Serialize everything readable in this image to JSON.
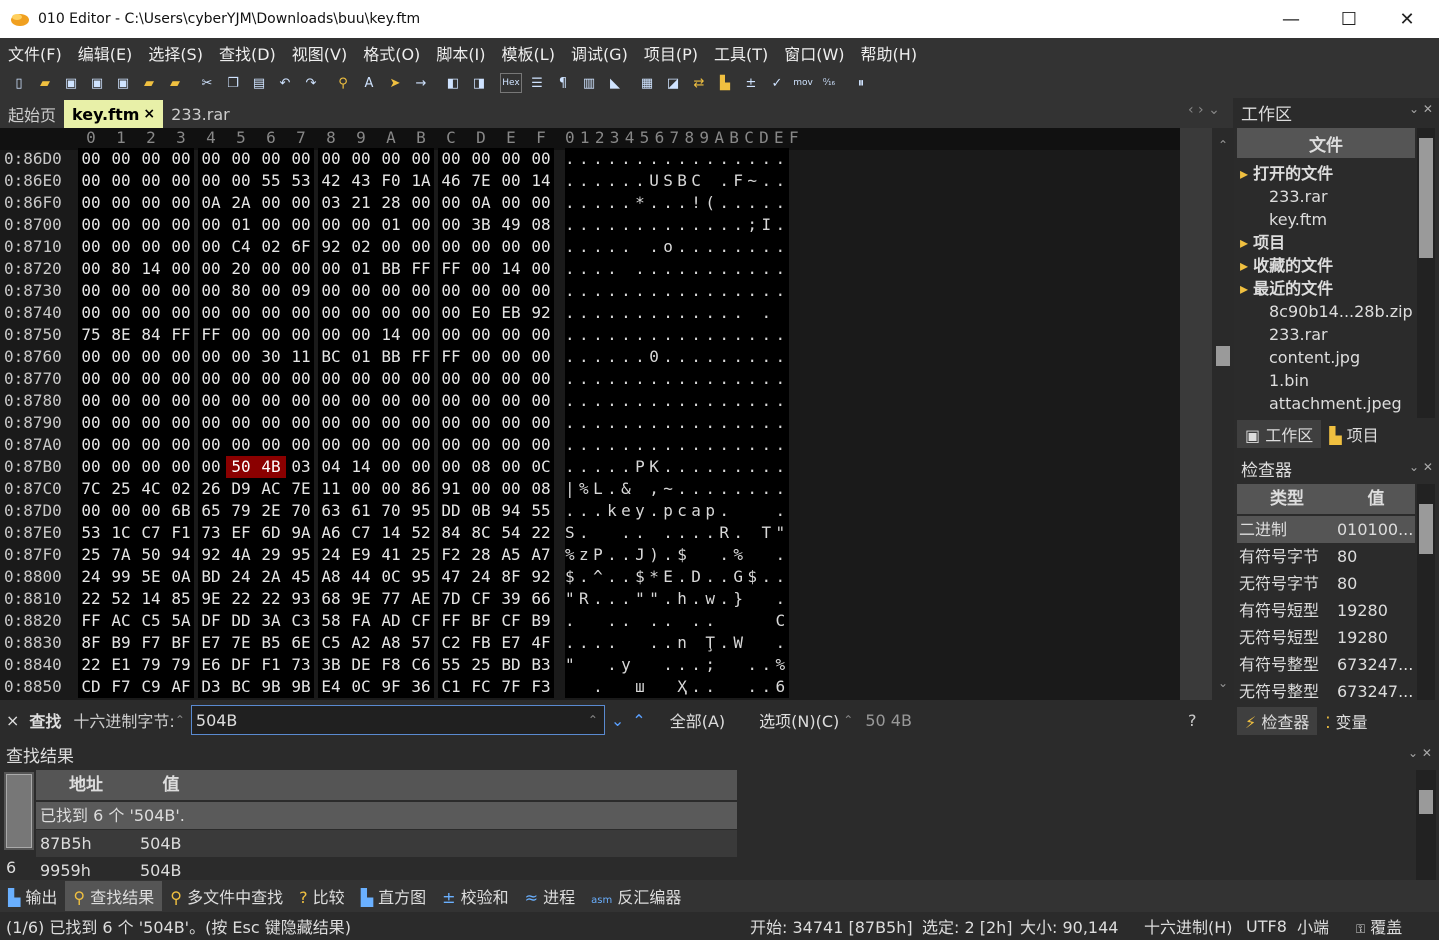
{
  "window": {
    "title": "010 Editor - C:\\Users\\cyberYJM\\Downloads\\buu\\key.ftm",
    "minimize": "—",
    "maximize": "☐",
    "close": "✕"
  },
  "menu": [
    "文件(F)",
    "编辑(E)",
    "选择(S)",
    "查找(D)",
    "视图(V)",
    "格式(O)",
    "脚本(I)",
    "模板(L)",
    "调试(G)",
    "项目(P)",
    "工具(T)",
    "窗口(W)",
    "帮助(H)"
  ],
  "tabs": {
    "start": "起始页",
    "active": "key.ftm",
    "active_close": "×",
    "other": "233.rar"
  },
  "hex": {
    "header_cols": [
      "0",
      "1",
      "2",
      "3",
      "4",
      "5",
      "6",
      "7",
      "8",
      "9",
      "A",
      "B",
      "C",
      "D",
      "E",
      "F"
    ],
    "ascii_header": "0123456789ABCDEF",
    "rows": [
      {
        "addr": "0:86D0",
        "bytes": [
          "00",
          "00",
          "00",
          "00",
          "00",
          "00",
          "00",
          "00",
          "00",
          "00",
          "00",
          "00",
          "00",
          "00",
          "00",
          "00"
        ],
        "ascii": "................"
      },
      {
        "addr": "0:86E0",
        "bytes": [
          "00",
          "00",
          "00",
          "00",
          "00",
          "00",
          "55",
          "53",
          "42",
          "43",
          "F0",
          "1A",
          "46",
          "7E",
          "00",
          "14"
        ],
        "ascii": "......USBC .F~.."
      },
      {
        "addr": "0:86F0",
        "bytes": [
          "00",
          "00",
          "00",
          "00",
          "0A",
          "2A",
          "00",
          "00",
          "03",
          "21",
          "28",
          "00",
          "00",
          "0A",
          "00",
          "00"
        ],
        "ascii": ".....*...!(....."
      },
      {
        "addr": "0:8700",
        "bytes": [
          "00",
          "00",
          "00",
          "00",
          "00",
          "01",
          "00",
          "00",
          "00",
          "00",
          "01",
          "00",
          "00",
          "3B",
          "49",
          "08"
        ],
        "ascii": ".............;I."
      },
      {
        "addr": "0:8710",
        "bytes": [
          "00",
          "00",
          "00",
          "00",
          "00",
          "C4",
          "02",
          "6F",
          "92",
          "02",
          "00",
          "00",
          "00",
          "00",
          "00",
          "00"
        ],
        "ascii": "..... .o........"
      },
      {
        "addr": "0:8720",
        "bytes": [
          "00",
          "80",
          "14",
          "00",
          "00",
          "20",
          "00",
          "00",
          "00",
          "01",
          "BB",
          "FF",
          "FF",
          "00",
          "14",
          "00"
        ],
        "ascii": ".... ..........."
      },
      {
        "addr": "0:8730",
        "bytes": [
          "00",
          "00",
          "00",
          "00",
          "00",
          "80",
          "00",
          "09",
          "00",
          "00",
          "00",
          "00",
          "00",
          "00",
          "00",
          "00"
        ],
        "ascii": "................"
      },
      {
        "addr": "0:8740",
        "bytes": [
          "00",
          "00",
          "00",
          "00",
          "00",
          "00",
          "00",
          "00",
          "00",
          "00",
          "00",
          "00",
          "00",
          "E0",
          "EB",
          "92"
        ],
        "ascii": "............. ."
      },
      {
        "addr": "0:8750",
        "bytes": [
          "75",
          "8E",
          "84",
          "FF",
          "FF",
          "00",
          "00",
          "00",
          "00",
          "00",
          "14",
          "00",
          "00",
          "00",
          "00",
          "00"
        ],
        "ascii": "................"
      },
      {
        "addr": "0:8760",
        "bytes": [
          "00",
          "00",
          "00",
          "00",
          "00",
          "00",
          "30",
          "11",
          "BC",
          "01",
          "BB",
          "FF",
          "FF",
          "00",
          "00",
          "00"
        ],
        "ascii": "......0........."
      },
      {
        "addr": "0:8770",
        "bytes": [
          "00",
          "00",
          "00",
          "00",
          "00",
          "00",
          "00",
          "00",
          "00",
          "00",
          "00",
          "00",
          "00",
          "00",
          "00",
          "00"
        ],
        "ascii": "................"
      },
      {
        "addr": "0:8780",
        "bytes": [
          "00",
          "00",
          "00",
          "00",
          "00",
          "00",
          "00",
          "00",
          "00",
          "00",
          "00",
          "00",
          "00",
          "00",
          "00",
          "00"
        ],
        "ascii": "................"
      },
      {
        "addr": "0:8790",
        "bytes": [
          "00",
          "00",
          "00",
          "00",
          "00",
          "00",
          "00",
          "00",
          "00",
          "00",
          "00",
          "00",
          "00",
          "00",
          "00",
          "00"
        ],
        "ascii": "................"
      },
      {
        "addr": "0:87A0",
        "bytes": [
          "00",
          "00",
          "00",
          "00",
          "00",
          "00",
          "00",
          "00",
          "00",
          "00",
          "00",
          "00",
          "00",
          "00",
          "00",
          "00"
        ],
        "ascii": "................"
      },
      {
        "addr": "0:87B0",
        "bytes": [
          "00",
          "00",
          "00",
          "00",
          "00",
          "50",
          "4B",
          "03",
          "04",
          "14",
          "00",
          "00",
          "00",
          "08",
          "00",
          "0C"
        ],
        "ascii": ".....PK........."
      },
      {
        "addr": "0:87C0",
        "bytes": [
          "7C",
          "25",
          "4C",
          "02",
          "26",
          "D9",
          "AC",
          "7E",
          "11",
          "00",
          "00",
          "86",
          "91",
          "00",
          "00",
          "08"
        ],
        "ascii": "|%L.& ,~........"
      },
      {
        "addr": "0:87D0",
        "bytes": [
          "00",
          "00",
          "00",
          "6B",
          "65",
          "79",
          "2E",
          "70",
          "63",
          "61",
          "70",
          "95",
          "DD",
          "0B",
          "94",
          "55"
        ],
        "ascii": "...key.pcap.   .U"
      },
      {
        "addr": "0:87E0",
        "bytes": [
          "53",
          "1C",
          "C7",
          "F1",
          "73",
          "EF",
          "6D",
          "9A",
          "A6",
          "C7",
          "14",
          "52",
          "84",
          "8C",
          "54",
          "22"
        ],
        "ascii": "S.  .. ....R. T\""
      },
      {
        "addr": "0:87F0",
        "bytes": [
          "25",
          "7A",
          "50",
          "94",
          "92",
          "4A",
          "29",
          "95",
          "24",
          "E9",
          "41",
          "25",
          "F2",
          "28",
          "A5",
          "A7"
        ],
        "ascii": "%zP..J).$  .%  ..."
      },
      {
        "addr": "0:8800",
        "bytes": [
          "24",
          "99",
          "5E",
          "0A",
          "BD",
          "24",
          "2A",
          "45",
          "A8",
          "44",
          "0C",
          "95",
          "47",
          "24",
          "8F",
          "92"
        ],
        "ascii": "$.^..$*E.D..G$.."
      },
      {
        "addr": "0:8810",
        "bytes": [
          "22",
          "52",
          "14",
          "85",
          "9E",
          "22",
          "22",
          "93",
          "68",
          "9E",
          "77",
          "AE",
          "7D",
          "CF",
          "39",
          "66"
        ],
        "ascii": "\"R...\"\".h.w.}  .f"
      },
      {
        "addr": "0:8820",
        "bytes": [
          "FF",
          "AC",
          "C5",
          "5A",
          "DF",
          "DD",
          "3A",
          "C3",
          "58",
          "FA",
          "AD",
          "CF",
          "FF",
          "BF",
          "CF",
          "B9"
        ],
        "ascii": ".  .. .. ..    C"
      },
      {
        "addr": "0:8830",
        "bytes": [
          "8F",
          "B9",
          "F7",
          "BF",
          "E7",
          "7E",
          "B5",
          "6E",
          "C5",
          "A2",
          "A8",
          "57",
          "C2",
          "FB",
          "E7",
          "4F"
        ],
        "ascii": "....  ..n Ţ.W  ."
      },
      {
        "addr": "0:8840",
        "bytes": [
          "22",
          "E1",
          "79",
          "79",
          "E6",
          "DF",
          "F1",
          "73",
          "3B",
          "DE",
          "F8",
          "C6",
          "55",
          "25",
          "BD",
          "B3"
        ],
        "ascii": "\"  .y  ...;  ..%.."
      },
      {
        "addr": "0:8850",
        "bytes": [
          "CD",
          "F7",
          "C9",
          "AF",
          "D3",
          "BC",
          "9B",
          "9B",
          "E4",
          "0C",
          "9F",
          "36",
          "C1",
          "FC",
          "7F",
          "F3"
        ],
        "ascii": "  .  ш  Ҳ..  ..6...."
      }
    ],
    "highlight_row": 14,
    "highlight_cols": [
      5,
      6
    ]
  },
  "workspace": {
    "title": "工作区",
    "files_header": "文件",
    "open_files_label": "打开的文件",
    "open_files": [
      "233.rar",
      "key.ftm"
    ],
    "projects_label": "项目",
    "favorites_label": "收藏的文件",
    "recent_label": "最近的文件",
    "recent_files": [
      "8c90b14...28b.zip",
      "233.rar",
      "content.jpg",
      "1.bin",
      "attachment.jpeg"
    ],
    "tab_workspace": "工作区",
    "tab_project": "项目"
  },
  "inspector": {
    "title": "检查器",
    "col_type": "类型",
    "col_value": "值",
    "rows": [
      {
        "type": "二进制",
        "value": "010100..."
      },
      {
        "type": "有符号字节",
        "value": "80"
      },
      {
        "type": "无符号字节",
        "value": "80"
      },
      {
        "type": "有符号短型",
        "value": "19280"
      },
      {
        "type": "无符号短型",
        "value": "19280"
      },
      {
        "type": "有符号整型",
        "value": "673247..."
      },
      {
        "type": "无符号整型",
        "value": "673247..."
      }
    ],
    "tab_inspector": "检查器",
    "tab_vars": "变量"
  },
  "find": {
    "close": "×",
    "label": "查找",
    "type_label": "十六进制字节:",
    "value": "504B",
    "all": "全部(A)",
    "options": "选项(N)(C)",
    "hint": "50 4B",
    "help": "?"
  },
  "results": {
    "title": "查找结果",
    "col_addr": "地址",
    "col_value": "值",
    "summary": "已找到 6 个 '504B'.",
    "rows": [
      {
        "addr": "87B5h",
        "value": "504B"
      },
      {
        "addr": "9959h",
        "value": "504B"
      }
    ],
    "side_count": "6"
  },
  "bottom_tabs": [
    "输出",
    "查找结果",
    "多文件中查找",
    "比较",
    "直方图",
    "校验和",
    "进程",
    "反汇编器"
  ],
  "status": {
    "left": "(1/6) 已找到 6 个 '504B'。(按 Esc 键隐藏结果)",
    "start": "开始: 34741 [87B5h]",
    "sel": "选定: 2 [2h]",
    "size": "大小: 90,144",
    "mode": "十六进制(H)",
    "enc": "UTF8",
    "endian": "小端",
    "ovr": "覆盖"
  },
  "colors": {
    "highlight": "#8b0000",
    "tab_active": "#e8f0a8",
    "selected_row": "#5a5a5a"
  }
}
